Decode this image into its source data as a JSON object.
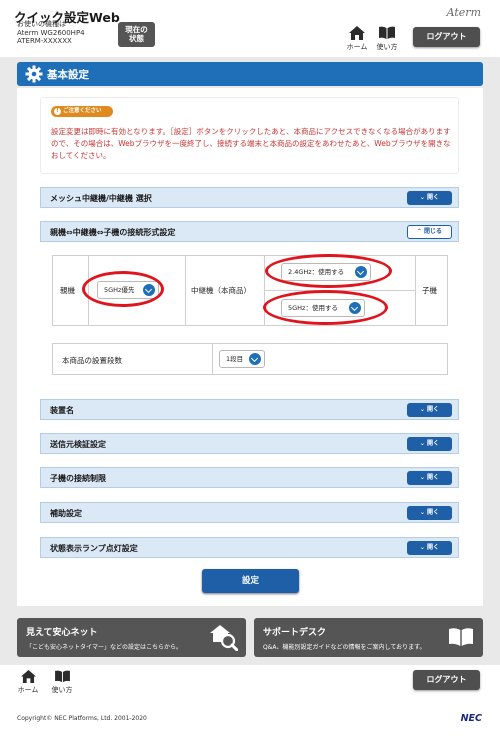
{
  "header": {
    "app_title": "クイック設定Web",
    "model_caption": "お使いの機種は",
    "model_name": "Aterm WG2600HP4",
    "model_serial": "ATERM-XXXXXX",
    "status_button_line1": "現在の",
    "status_button_line2": "状態",
    "brand": "Aterm",
    "home_label": "ホーム",
    "help_label": "使い方",
    "logout_label": "ログアウト"
  },
  "page": {
    "title": "基本設定",
    "gear_icon": "gear-icon"
  },
  "notice": {
    "badge": "ご注意ください",
    "text": "設定変更は即時に有効となります。［設定］ボタンをクリックしたあと、本商品にアクセスできなくなる場合がありますので、その場合は、Webブラウザを一度終了し、接続する端末と本商品の設定をあわせたあと、Webブラウザを開きなおしてください。"
  },
  "sections": {
    "mesh": {
      "label": "メッシュ中継機/中継機 選択",
      "button": "開く"
    },
    "connection": {
      "label": "親機⇔中継機⇔子機の接続形式設定",
      "button": "閉じる"
    },
    "device_name": {
      "label": "装置名",
      "button": "開く"
    },
    "sender_verify": {
      "label": "送信元検証設定",
      "button": "開く"
    },
    "child_limit": {
      "label": "子機の接続制限",
      "button": "開く"
    },
    "aux": {
      "label": "補助設定",
      "button": "開く"
    },
    "lamp": {
      "label": "状態表示ランプ点灯設定",
      "button": "開く"
    }
  },
  "connection_table": {
    "parent_label": "親機",
    "parent_select": "5GHz優先",
    "relay_label": "中継機（本商品）",
    "relay_24_select": "2.4GHz：使用する",
    "relay_5_select": "5GHz：使用する",
    "child_label": "子機"
  },
  "install_count": {
    "label": "本商品の設置段数",
    "select": "1段目"
  },
  "apply_label": "設定",
  "banners": {
    "safety_title": "見えて安心ネット",
    "safety_desc": "「こども安心ネットタイマー」などの設定はこちらから。",
    "support_title": "サポートデスク",
    "support_desc": "Q&A、機能別設定ガイドなどの情報をご案内しております。"
  },
  "footer": {
    "home_label": "ホーム",
    "help_label": "使い方",
    "logout_label": "ログアウト",
    "copyright": "Copyright© NEC Platforms, Ltd. 2001-2020",
    "nec_logo": "NEC"
  },
  "colors": {
    "primary_blue": "#1f6fb8",
    "button_blue": "#1f5fa8",
    "section_bg": "#dbe8f6",
    "warning_red": "#cc3333",
    "highlight_ring": "#e0141d",
    "dark_gray": "#555555"
  }
}
